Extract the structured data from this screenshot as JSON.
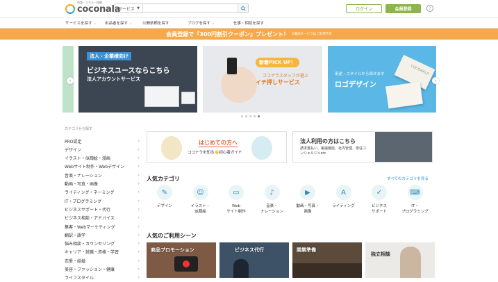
{
  "header": {
    "logo_text": "coconala",
    "logo_sub": "知識・スキル・経験",
    "search": {
      "category": "サービス",
      "placeholder": ""
    },
    "login_label": "ログイン",
    "signup_label": "会員登録",
    "help_label": "?"
  },
  "nav": {
    "items": [
      {
        "label": "サービスを探す",
        "chevron": true
      },
      {
        "label": "出品者を探す",
        "chevron": true
      },
      {
        "label": "公開依頼を探す",
        "chevron": false
      },
      {
        "label": "ブログを探す",
        "chevron": true
      },
      {
        "label": "仕事・相談を探す",
        "chevron": false
      }
    ]
  },
  "promo": {
    "main": "会員登録で『300円割引クーポン』プレゼント！",
    "note": "※電話サービスはご利用不可"
  },
  "carousel": {
    "slide1": {
      "tag": "法人・企業様向け",
      "title": "ビジネスユースならこちら",
      "subtitle": "法人アカウントサービス"
    },
    "slide2": {
      "badge": "新着PICK UP！",
      "line1": "ココナラスタッフが選ぶ",
      "line2": "イチ押しサービス"
    },
    "slide3": {
      "line1": "用途・スタイルから探せます",
      "title": "ロゴデザイン",
      "card_logo": "COCONALA"
    },
    "prev": "‹",
    "next": "›",
    "dot_count": 5,
    "active_dot": 4
  },
  "sidebar": {
    "title": "カテゴリから探す",
    "items": [
      "PRO認定",
      "デザイン",
      "イラスト・似顔絵・漫画",
      "Webサイト制作・Webデザイン",
      "音楽・ナレーション",
      "動画・写真・画像",
      "ライティング・ネーミング",
      "IT・プログラミング",
      "ビジネスサポート・代行",
      "ビジネス相談・アドバイス",
      "集客・Webマーケティング",
      "翻訳・語学",
      "悩み相談・カウンセリング",
      "キャリア・就職・資格・学習",
      "恋愛・結婚",
      "美容・ファッション・健康",
      "ライフスタイル"
    ]
  },
  "banners": {
    "first_time": {
      "title": "はじめての方へ",
      "sub": "ココナラを知る👋初心者ガイド"
    },
    "corporate": {
      "title": "法人利用の方はこちら",
      "sub": "請求書払い、稟議機能、社内管理、専任コンシェルジュetc."
    }
  },
  "popular_categories": {
    "title": "人気カテゴリ",
    "see_all": "すべてのカテゴリを見る",
    "items": [
      {
        "label": "デザイン",
        "icon": "design-icon"
      },
      {
        "label": "イラスト・\n似顔絵",
        "icon": "illustration-icon"
      },
      {
        "label": "Web\nサイト制作",
        "icon": "web-icon"
      },
      {
        "label": "音楽・\nナレーション",
        "icon": "music-icon"
      },
      {
        "label": "動画・写真・\n画像",
        "icon": "video-icon"
      },
      {
        "label": "ライティング",
        "icon": "writing-icon"
      },
      {
        "label": "ビジネス\nサポート",
        "icon": "business-icon"
      },
      {
        "label": "IT・\nプログラミング",
        "icon": "programming-icon"
      }
    ]
  },
  "scenes": {
    "title": "人気のご利用シーン",
    "items": [
      "商品プロモーション",
      "ビジネス代行",
      "開業準備",
      "独立相談"
    ]
  }
}
